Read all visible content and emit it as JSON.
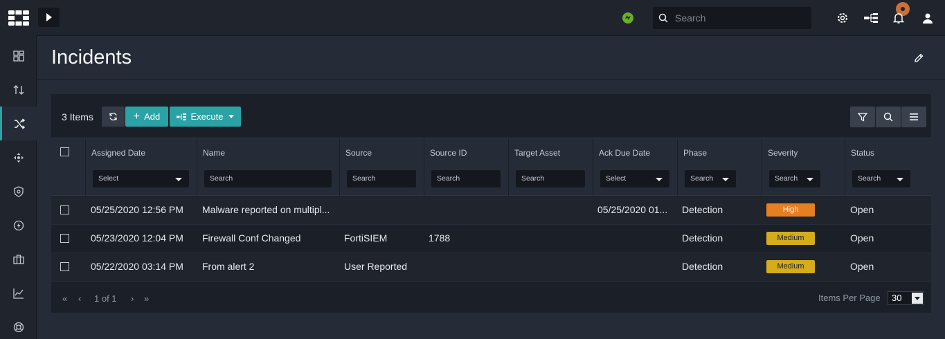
{
  "topbar": {
    "search_placeholder": "Search",
    "icons": [
      "gear-icon",
      "network-icon",
      "bell-icon",
      "user-icon"
    ],
    "status_color": "#6ab023"
  },
  "sidebar": {
    "items": [
      "dashboard-icon",
      "sort-icon",
      "shuffle-icon",
      "move-icon",
      "shield-icon",
      "bolt-icon",
      "briefcase-icon",
      "chart-icon",
      "support-icon"
    ],
    "active_index": 2
  },
  "page": {
    "title": "Incidents"
  },
  "toolbar": {
    "items_count": "3 Items",
    "add_label": "Add",
    "execute_label": "Execute"
  },
  "table": {
    "columns": [
      {
        "label": "Assigned Date",
        "filter": "Select"
      },
      {
        "label": "Name",
        "filter": "Search"
      },
      {
        "label": "Source",
        "filter": "Search"
      },
      {
        "label": "Source ID",
        "filter": "Search"
      },
      {
        "label": "Target Asset",
        "filter": "Search"
      },
      {
        "label": "Ack Due Date",
        "filter": "Select"
      },
      {
        "label": "Phase",
        "filter": "Search"
      },
      {
        "label": "Severity",
        "filter": "Search"
      },
      {
        "label": "Status",
        "filter": "Search"
      }
    ],
    "rows": [
      {
        "assigned": "05/25/2020 12:56 PM",
        "name": "Malware reported on multipl...",
        "source": "",
        "source_id": "",
        "target": "",
        "ack": "05/25/2020 01...",
        "phase": "Detection",
        "severity": "High",
        "status": "Open"
      },
      {
        "assigned": "05/23/2020 12:04 PM",
        "name": "Firewall Conf Changed",
        "source": "FortiSIEM",
        "source_id": "1788",
        "target": "",
        "ack": "",
        "phase": "Detection",
        "severity": "Medium",
        "status": "Open"
      },
      {
        "assigned": "05/22/2020 03:14 PM",
        "name": "From alert 2",
        "source": "User Reported",
        "source_id": "",
        "target": "",
        "ack": "",
        "phase": "Detection",
        "severity": "Medium",
        "status": "Open"
      }
    ],
    "severity_colors": {
      "High": "#e67e22",
      "Medium": "#d4ac1c"
    }
  },
  "footer": {
    "page_info": "1 of 1",
    "items_per_page_label": "Items Per Page",
    "items_per_page_value": "30"
  }
}
